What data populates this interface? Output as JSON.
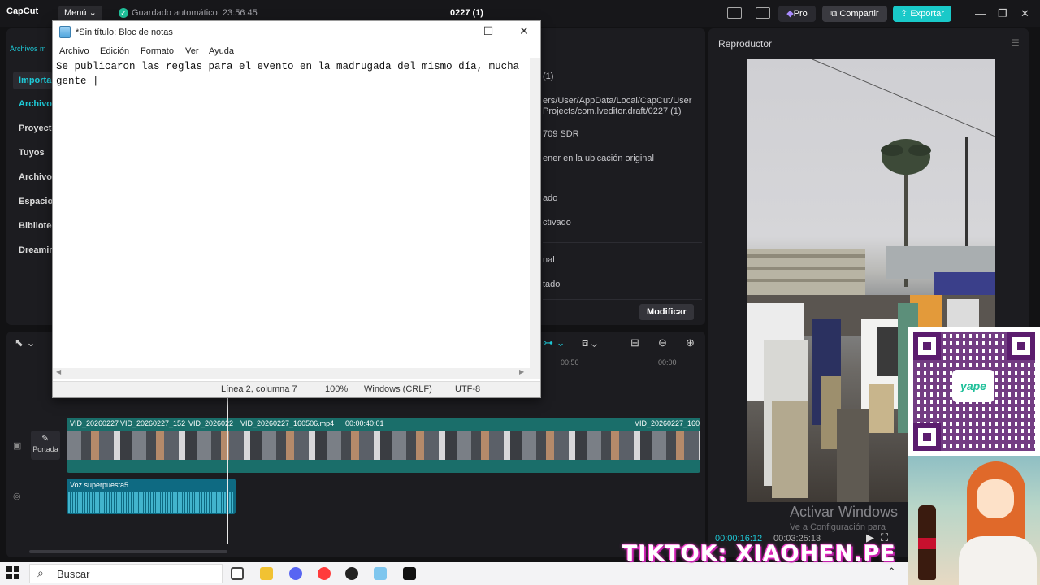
{
  "capcut": {
    "app_name": "CapCut",
    "menu_label": "Menú",
    "autosave_text": "Guardado automático: 23:56:45",
    "project_title": "0227 (1)",
    "pro_label": "Pro",
    "share_label": "Compartir",
    "export_label": "Exportar",
    "top_tab_label": "Archivos m",
    "sidebar": [
      {
        "label": "Importar"
      },
      {
        "label": "Archivo"
      },
      {
        "label": "Proyecto"
      },
      {
        "label": "Tuyos"
      },
      {
        "label": "Archivos"
      },
      {
        "label": "Espacio"
      },
      {
        "label": "Bibliotec"
      },
      {
        "label": "Dreamin"
      }
    ],
    "properties": {
      "name_partial": "(1)",
      "path_line1": "ers/User/AppData/Local/CapCut/User",
      "path_line2": "Projects/com.lveditor.draft/0227 (1)",
      "color_space": "709 SDR",
      "save_option": "ener en la ubicación original",
      "status1": "ado",
      "status2": "ctivado",
      "status3": "nal",
      "status4": "tado",
      "modify_label": "Modificar"
    },
    "player": {
      "title": "Reproductor",
      "time_current": "00:00:16:12",
      "time_total": "00:03:25:13"
    },
    "timeline": {
      "ruler_marks": [
        "00:50",
        "00:00"
      ],
      "cover_label": "Portada",
      "clips": [
        {
          "label": "VID_20260227"
        },
        {
          "label": "VID_20260227_152"
        },
        {
          "label": "VID_2026022"
        },
        {
          "label": "VID_20260227_160506.mp4"
        },
        {
          "label": "00:00:40:01"
        },
        {
          "label": "VID_20260227_160"
        }
      ],
      "voice_label": "Voz superpuesta5"
    }
  },
  "notepad": {
    "title": "*Sin título: Bloc de notas",
    "menu": [
      "Archivo",
      "Edición",
      "Formato",
      "Ver",
      "Ayuda"
    ],
    "content": "Se publicaron las reglas para el evento en la madrugada del mismo día, mucha\ngente |",
    "status": {
      "position": "Línea 2, columna 7",
      "zoom": "100%",
      "line_ending": "Windows (CRLF)",
      "encoding": "UTF-8"
    }
  },
  "watermark": {
    "title": "Activar Windows",
    "subtitle": "Ve a Configuración para"
  },
  "overlays": {
    "tiktok_handle": "TIKTOK: XIAOHEN.PE",
    "yape_label": "yape"
  },
  "taskbar": {
    "search_placeholder": "Buscar"
  },
  "colors": {
    "accent": "#1ec8d6",
    "export": "#19c9c9",
    "track": "#1a6e6a",
    "voice": "#0e6a82"
  }
}
